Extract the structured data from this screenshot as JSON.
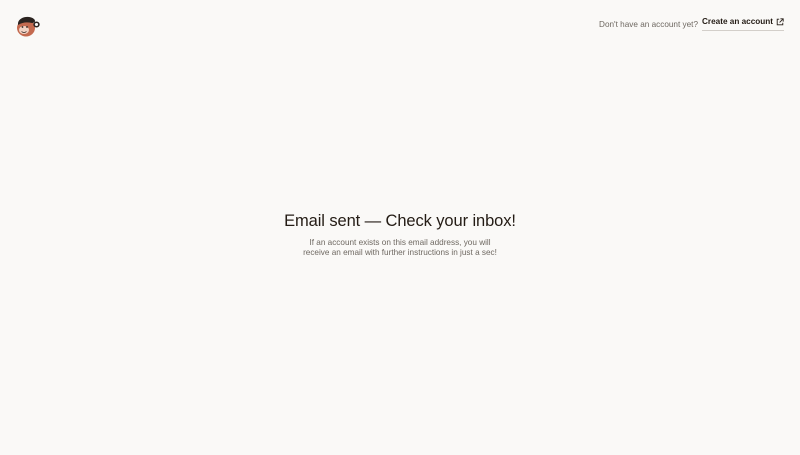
{
  "header": {
    "logo_icon": "mailchimp-freddie-icon",
    "prompt_text": "Don't have an account yet?",
    "create_account_label": "Create an account",
    "external_icon": "external-link-icon"
  },
  "main": {
    "title": "Email sent — Check your inbox!",
    "message": "If an account exists on this email address, you will receive an email with further instructions in just a sec!"
  },
  "colors": {
    "background": "#faf9f7",
    "text": "#241c15",
    "muted_text": "#6e6861",
    "link_underline": "#d3cfca"
  }
}
